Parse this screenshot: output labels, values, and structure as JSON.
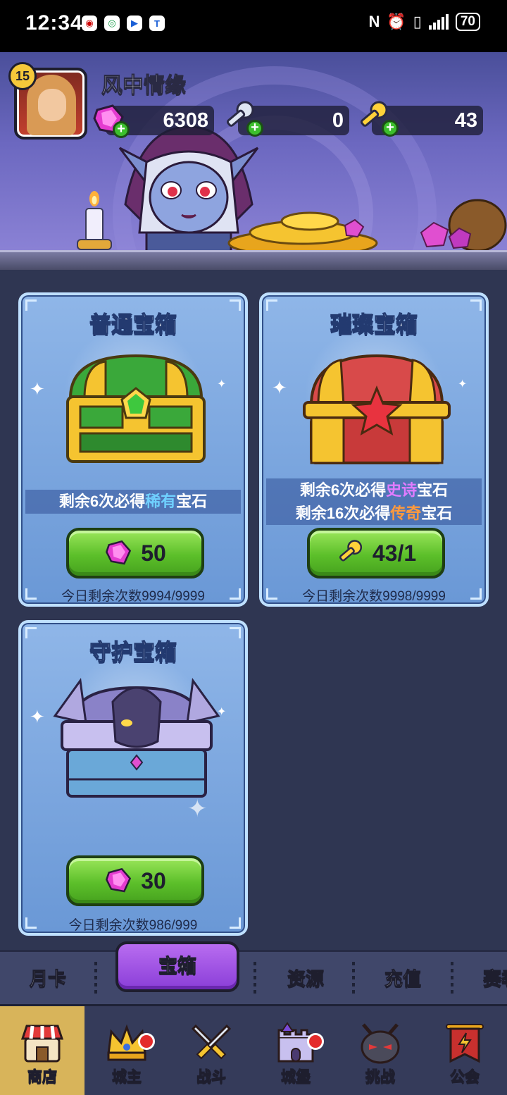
{
  "status_bar": {
    "time": "12:34",
    "battery": "70"
  },
  "player": {
    "level": "15",
    "name": "风中情缘"
  },
  "resources": {
    "gems": "6308",
    "silver_keys": "0",
    "gold_keys": "43"
  },
  "chests": [
    {
      "title": "普通宝箱",
      "guarantee_prefix": "剩余6次必得",
      "guarantee_highlight": "稀有",
      "guarantee_suffix": "宝石",
      "price": "50",
      "remaining": "今日剩余次数9994/9999"
    },
    {
      "title": "璀璨宝箱",
      "guarantee_prefix": "剩余6次必得",
      "guarantee_highlight": "史诗",
      "guarantee_suffix": "宝石",
      "guarantee2_prefix": "剩余16次必得",
      "guarantee2_highlight": "传奇",
      "guarantee2_suffix": "宝石",
      "price": "43/1",
      "remaining": "今日剩余次数9998/9999"
    },
    {
      "title": "守护宝箱",
      "price": "30",
      "remaining": "今日剩余次数986/999"
    }
  ],
  "shop_tabs": {
    "month_card": "月卡",
    "chest": "宝箱",
    "resources": "资源",
    "recharge": "充值",
    "season": "赛季"
  },
  "nav": [
    {
      "label": "商店"
    },
    {
      "label": "城主"
    },
    {
      "label": "战斗"
    },
    {
      "label": "城堡"
    },
    {
      "label": "挑战"
    },
    {
      "label": "公会"
    }
  ],
  "colors": {
    "background": "#2f3652",
    "card": "#7aa6df",
    "buy_button": "#5cbf2a",
    "active_tab": "#9a4ee0",
    "active_nav": "#d8b45a",
    "rare": "#6fd0ff",
    "epic": "#e07cff",
    "legend": "#ff9a3c"
  }
}
